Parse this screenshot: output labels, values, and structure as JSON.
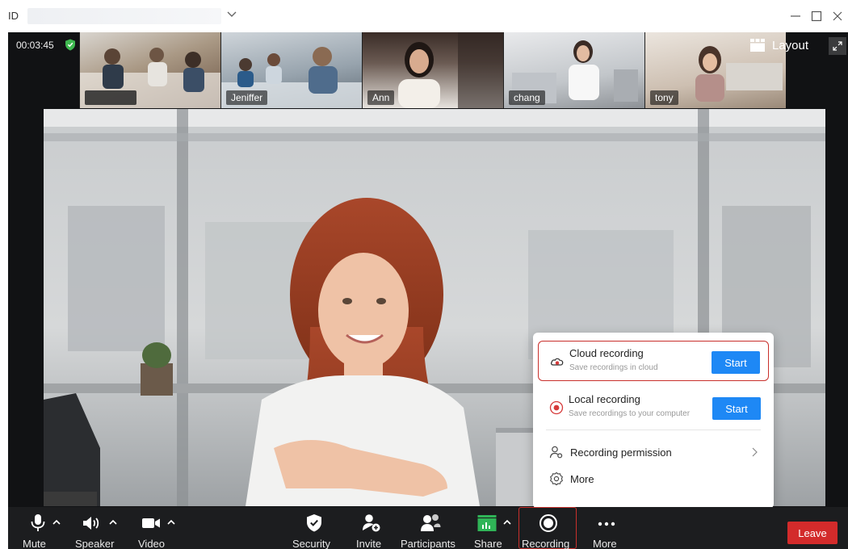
{
  "window": {
    "id_label": "ID"
  },
  "status": {
    "timer": "00:03:45"
  },
  "participants_strip": [
    {
      "name": "",
      "colors": [
        "#8a6d55",
        "#d9d5cf"
      ]
    },
    {
      "name": "Jeniffer",
      "colors": [
        "#6f7b86",
        "#cfd5da"
      ]
    },
    {
      "name": "Ann",
      "colors": [
        "#3b2e2a",
        "#e8e4e0"
      ]
    },
    {
      "name": "chang",
      "colors": [
        "#9aa1a8",
        "#e9eaec"
      ]
    },
    {
      "name": "tony",
      "colors": [
        "#b79b86",
        "#ebe5de"
      ]
    }
  ],
  "layout_button": {
    "label": "Layout"
  },
  "recording_popup": {
    "cloud": {
      "title": "Cloud recording",
      "subtitle": "Save recordings in cloud",
      "start_label": "Start"
    },
    "local": {
      "title": "Local recording",
      "subtitle": "Save recordings to your computer",
      "start_label": "Start"
    },
    "permission_label": "Recording permission",
    "more_label": "More"
  },
  "toolbar": {
    "mute": "Mute",
    "speaker": "Speaker",
    "video": "Video",
    "security": "Security",
    "invite": "Invite",
    "participants": "Participants",
    "share": "Share",
    "recording": "Recording",
    "more": "More",
    "leave": "Leave"
  },
  "colors": {
    "accent_blue": "#1e88f5",
    "leave_red": "#d32b2b",
    "highlight_red": "#c9302c",
    "security_green": "#3fb950",
    "share_green": "#2fb457"
  }
}
